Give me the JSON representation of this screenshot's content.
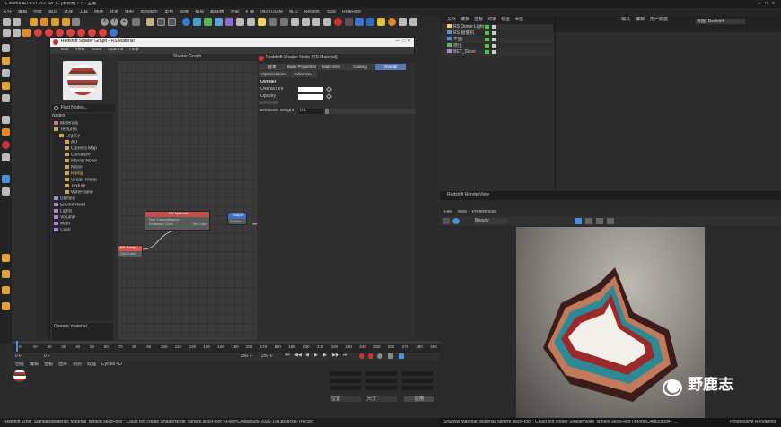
{
  "window": {
    "title": "Cinema 4D R21.207 (RC) - [未标题 1 *] - 主要",
    "menus": [
      "文件",
      "编辑",
      "创建",
      "模式",
      "选择",
      "工具",
      "网格",
      "样条",
      "体积",
      "运动图形",
      "角色",
      "动画",
      "模拟",
      "跟踪器",
      "渲染",
      "扩展",
      "INSYDIUM",
      "窗口",
      "Redshift",
      "帮助",
      "RealFlow"
    ],
    "layout_label": "界面: Redshift"
  },
  "toolbar": {
    "xyz": [
      "X",
      "Y",
      "Z"
    ]
  },
  "shader_dialog": {
    "title": "Redshift Shader Graph - RS Material",
    "menu": [
      "Edit",
      "View",
      "Tools",
      "Options",
      "Help"
    ],
    "find_nodes": "Find Nodes...",
    "nodes_header": "Nodes",
    "tree": [
      "Materials",
      "Textures",
      "Legacy",
      "AO",
      "Camera Map",
      "Curvature",
      "Maxon Noise",
      "Noise",
      "Ramp",
      "Scalar Ramp",
      "Texture",
      "WireFrame",
      "Utilities",
      "Environment",
      "Lights",
      "Volume",
      "Math",
      "Color"
    ],
    "generic_label": "Generic material",
    "graph_header": "Shader Graph",
    "nodes": {
      "ramp": {
        "title": "RS Ramp",
        "port": "Out Color"
      },
      "material": {
        "title": "RS Material",
        "ports_in": [
          "Refl Transmittance",
          "Emission Color"
        ],
        "port_out": "Out Color"
      },
      "output": {
        "title": "Output",
        "port": "Surface"
      }
    },
    "props": {
      "header": "Redshift Shader Node [RS Material]",
      "tabs_row1": [
        "基本",
        "Base Properties",
        "Multi-SSS",
        "Coating",
        "Overall"
      ],
      "tabs_row2": [
        "Optimizations",
        "Advanced"
      ],
      "active_tab": "Overall",
      "section": "Overall",
      "rows": [
        {
          "label": "Overall Tint",
          "kind": "color"
        },
        {
          "label": "Opacity",
          "kind": "color"
        },
        {
          "label": "Emission",
          "kind": "none"
        },
        {
          "label": "Emission Weight",
          "value": "0.1"
        }
      ]
    }
  },
  "object_manager": {
    "menu": [
      "文件",
      "编辑",
      "查看",
      "对象",
      "标签",
      "书签"
    ],
    "objects": [
      "RS Dome Light",
      "RS 摄像机",
      "平面",
      "挤压",
      "BET_Slicer"
    ],
    "attr_menu": [
      "模式",
      "编辑",
      "用户数据"
    ]
  },
  "render_view": {
    "title": "Redshift RenderView",
    "menu": [
      "File",
      "View",
      "Preferences"
    ],
    "mode": "Beauty",
    "status": "Shadow Material: Material 'sphere.sk@Floor': Could not create ShaderNode 'sphere.sk@Floor (\\Floor\\Ci4d6c80d4-' ...",
    "status_right": "Progressive Rendering"
  },
  "timeline": {
    "ticks": [
      "0",
      "10",
      "20",
      "30",
      "40",
      "50",
      "60",
      "70",
      "80",
      "90",
      "100",
      "110",
      "120",
      "130",
      "140",
      "150",
      "160",
      "170",
      "180",
      "190",
      "200",
      "210",
      "220",
      "230",
      "240",
      "250",
      "260",
      "270",
      "280",
      "290",
      "0 F"
    ],
    "start": "0 F",
    "end": "250 F",
    "end2": "250 F"
  },
  "material_manager": {
    "menu": [
      "创建",
      "编辑",
      "查看",
      "选择",
      "材质",
      "纹理",
      "Cycles 4D"
    ],
    "coords_labels": [
      "位置",
      "尺寸",
      "旋转"
    ],
    "apply_label": "应用"
  },
  "statusbar": {
    "text": "Redshift Error: StandardMaterial: Material 'sphere.sk@Floor': Could not create ShaderNode 'sphere.sk@Floor (\\Floor\\Ci4d6b6d9-2026-1983b6dc6e-7f4c0f0'"
  },
  "watermark": "野鹿志",
  "colors": {
    "accent_tab": "#5b78b6",
    "ramp_node": "#d2574a",
    "material_node": "#c0504d",
    "output_node": "#3b6fc9"
  }
}
